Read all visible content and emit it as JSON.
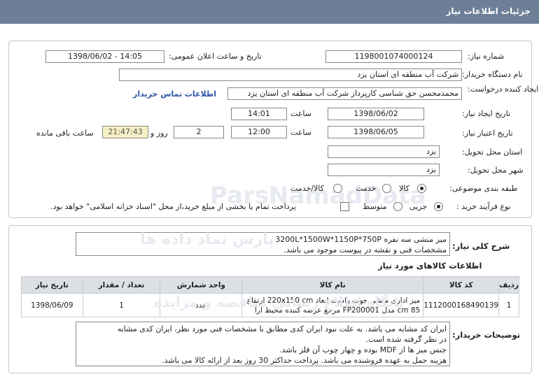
{
  "header": {
    "title": "جزئیات اطلاعات نیاز"
  },
  "need_info": {
    "need_number_label": "شماره نیاز:",
    "need_number": "1198001074000124",
    "announce_label": "تاریخ و ساعت اعلان عمومی:",
    "announce_value": "1398/06/02 - 14:05",
    "buyer_label": "نام دستگاه خریدار:",
    "buyer_value": "شرکت آب منطقه ای استان یزد",
    "creator_label": "ایجاد کننده درخواست:",
    "creator_value": "محمدمحسن حق شناسی کارپرداز شرکت آب منطقه ای استان یزد",
    "contact_link": "اطلاعات تماس خریدار",
    "create_date_label": "تاریخ ایجاد نیاز:",
    "create_date": "1398/06/02",
    "time_label": "ساعت",
    "create_time": "14:01",
    "validity_label": "تاریخ اعتبار نیاز:",
    "validity_date": "1398/06/05",
    "validity_time": "12:00",
    "days_label": "روز و",
    "days_value": "2",
    "remaining_time": "21:47:43",
    "remaining_label": "ساعت باقی مانده",
    "province_label": "استان محل تحویل:",
    "province_value": "یزد",
    "city_label": "شهر محل تحویل:",
    "city_value": "یزد",
    "category_label": "طبقه بندی موضوعی:",
    "category_options": [
      "کالا",
      "خدمت",
      "کالا/خدمت"
    ],
    "category_selected": "کالا",
    "process_label": "نوع فرآیند خرید :",
    "process_options": [
      "جزیی",
      "متوسط"
    ],
    "process_selected": "جزیی",
    "payment_note": "پرداخت تمام یا بخشی از مبلغ خرید،از محل \"اسناد خزانه اسلامی\" خواهد بود."
  },
  "description": {
    "label": "شرح کلی نیاز:",
    "line1": "میز منشی سه نفره 3200L*1500W*1150P*750P",
    "line2": "مشخصات فنی و نقشه در پیوست موجود می باشد."
  },
  "items_section": {
    "title": "اطلاعات کالاهای مورد نیاز",
    "columns": [
      "ردیف",
      "کد کالا",
      "نام کالا",
      "واحد شمارش",
      "تعداد / مقدار",
      "تاریخ نیاز"
    ],
    "rows": [
      {
        "index": "1",
        "code": "1112000168490139",
        "name": "میز اداری منشی جهت راست ابعاد 220x150 cm ارتفاع 85 cm مدل FP200001 مرجع عرضه کننده محیط آرا",
        "unit": "عدد",
        "qty": "1",
        "date": "1398/06/09"
      }
    ]
  },
  "buyer_notes": {
    "label": "توضیحات خریدار:",
    "line1": "ایران کد مشابه می باشد. به علت نبود ایران کدی مطابق با مشخصات فنی مورد نظر، ایران کدی مشابه",
    "line2": "در نظر گرفته شده است.",
    "line3": "جنس میز ها از MDF بوده و چهار چوب آن فلز باشد.",
    "line4": "هزینه حمل به عهده فروشنده می باشد. پرداخت حداکثر 30 روز بعد از ارائه کالا می باشد."
  },
  "watermark": {
    "line1": "ParsNamadData",
    "line2": "پارس نماد داده ها",
    "line3": "پایگاه اطلاع رسانی مناقصه و مزایده"
  }
}
